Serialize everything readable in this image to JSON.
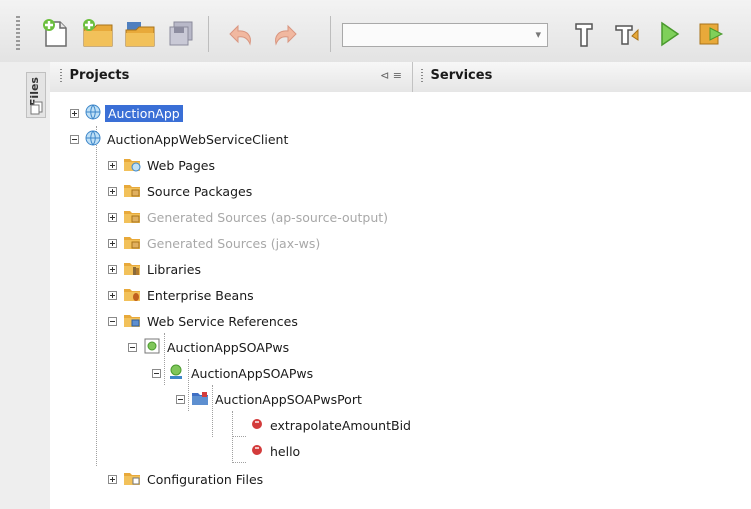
{
  "panels": {
    "left_tab": "Files",
    "projects_tab": "Projects",
    "services_tab": "Services"
  },
  "toolbar": {
    "buttons": [
      "new-file-icon",
      "new-project-icon",
      "open-project-icon",
      "save-all-icon",
      "undo-icon",
      "redo-icon",
      "clean-build-icon",
      "build-icon",
      "run-icon",
      "debug-icon"
    ],
    "config_combo_value": ""
  },
  "tree": [
    {
      "label": "AuctionApp",
      "icon": "globe-icon",
      "state": "collapsed",
      "selected": true
    },
    {
      "label": "AuctionAppWebServiceClient",
      "icon": "globe-icon",
      "state": "expanded"
    },
    {
      "label": "Web Pages",
      "icon": "web-pages-folder-icon",
      "state": "collapsed"
    },
    {
      "label": "Source Packages",
      "icon": "source-folder-icon",
      "state": "collapsed"
    },
    {
      "label": "Generated Sources (ap-source-output)",
      "icon": "generated-folder-icon",
      "state": "collapsed",
      "dim": true
    },
    {
      "label": "Generated Sources (jax-ws)",
      "icon": "generated-folder-icon",
      "state": "collapsed",
      "dim": true
    },
    {
      "label": "Libraries",
      "icon": "libraries-folder-icon",
      "state": "collapsed"
    },
    {
      "label": "Enterprise Beans",
      "icon": "beans-folder-icon",
      "state": "collapsed"
    },
    {
      "label": "Web Service References",
      "icon": "ws-references-folder-icon",
      "state": "expanded"
    },
    {
      "label": "AuctionAppSOAPws",
      "icon": "wsdl-icon",
      "state": "expanded"
    },
    {
      "label": "AuctionAppSOAPws",
      "icon": "service-icon",
      "state": "expanded"
    },
    {
      "label": "AuctionAppSOAPwsPort",
      "icon": "port-icon",
      "state": "expanded"
    },
    {
      "label": "extrapolateAmountBid",
      "icon": "operation-icon",
      "state": "leaf"
    },
    {
      "label": "hello",
      "icon": "operation-icon",
      "state": "leaf"
    },
    {
      "label": "Configuration Files",
      "icon": "config-folder-icon",
      "state": "collapsed"
    }
  ],
  "colors": {
    "selection": "#3a6fd6",
    "folder": "#e8a93a",
    "operation": "#d33b3b",
    "globe": "#3d86c9"
  }
}
